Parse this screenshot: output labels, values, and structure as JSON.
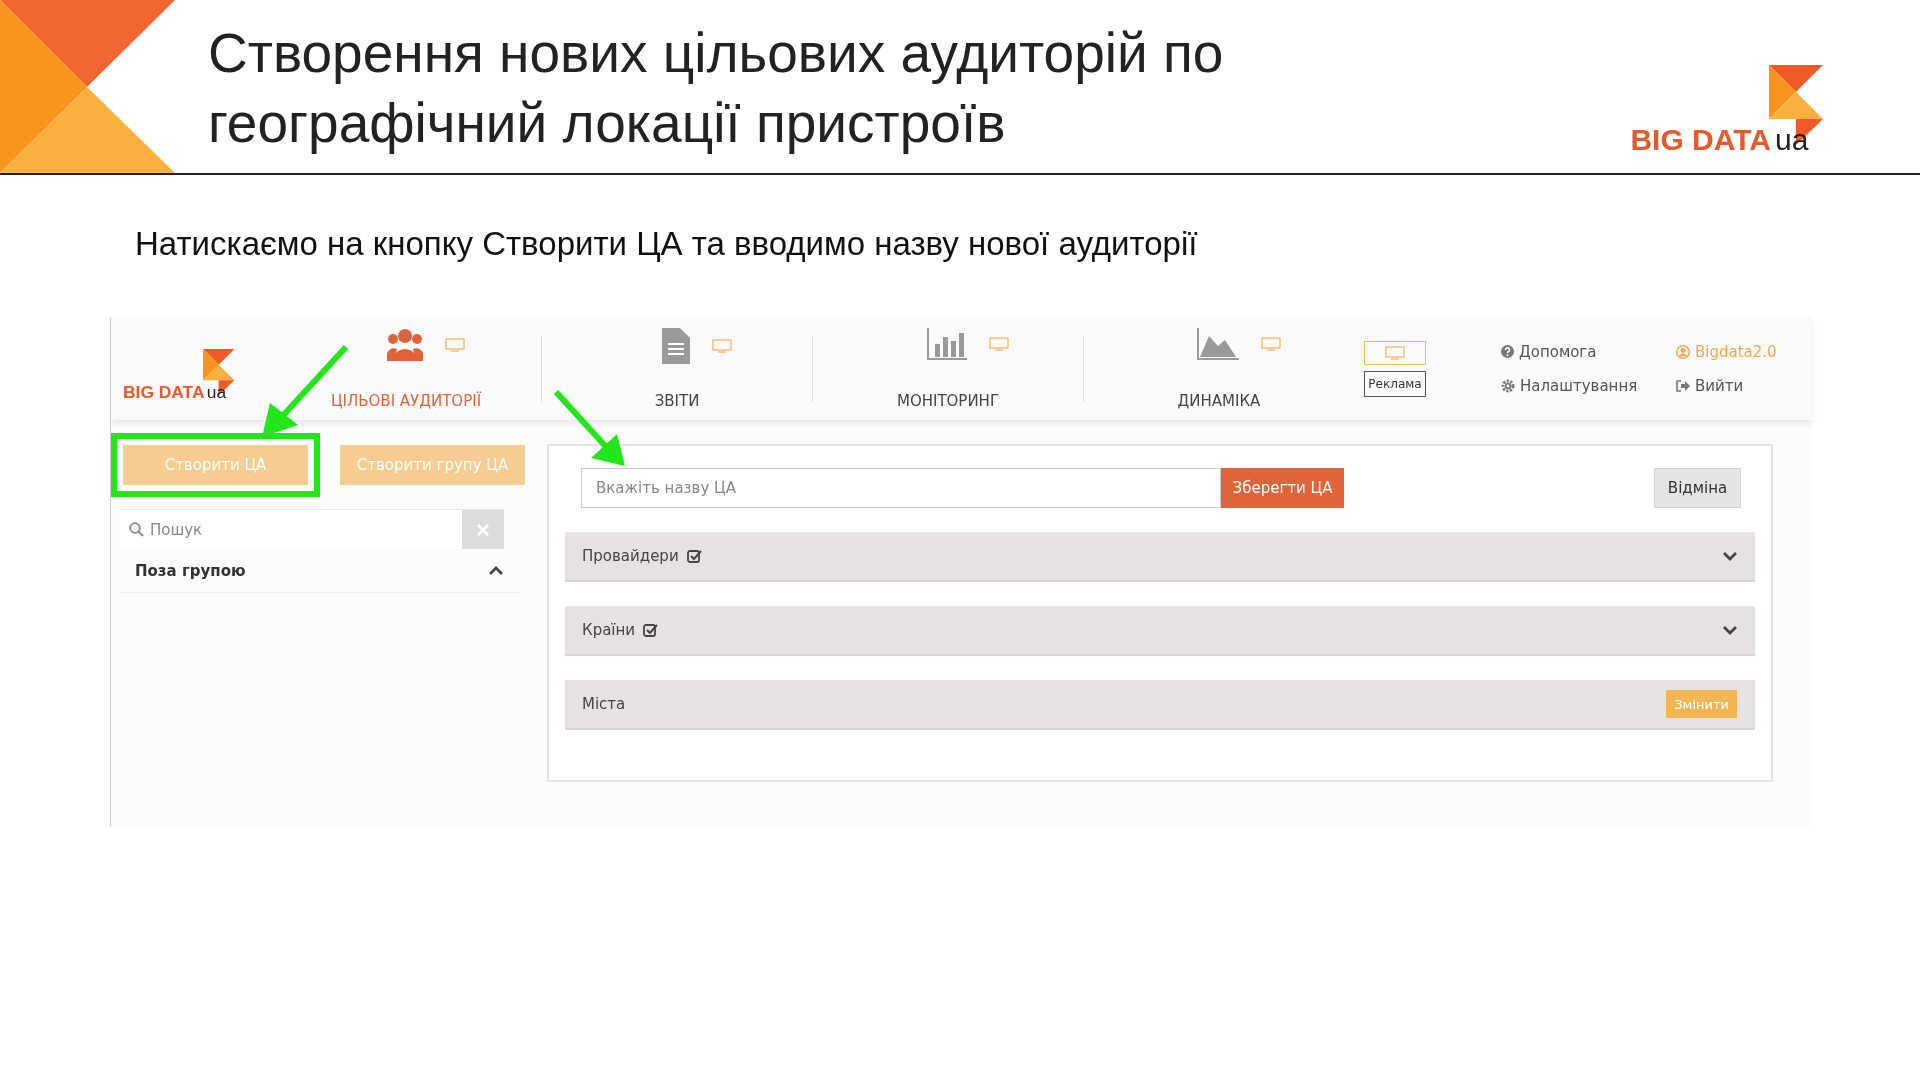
{
  "slide": {
    "title_lines": [
      "Створення нових цільових аудиторій по",
      "географічний локації пристроїв"
    ],
    "logo": {
      "text": "BIG DATA",
      "suffix": "ua"
    },
    "subtitle": "Натискаємо на кнопку Створити ЦА та вводимо назву нової аудиторії"
  },
  "app": {
    "logo": {
      "text": "BIG DATA",
      "suffix": "ua"
    },
    "nav": [
      {
        "kind": "people",
        "label": "ЦІЛЬОВІ АУДИТОРІЇ",
        "selected": true
      },
      {
        "kind": "document",
        "label": "ЗВІТИ",
        "selected": false
      },
      {
        "kind": "bars",
        "label": "МОНІТОРИНГ",
        "selected": false
      },
      {
        "kind": "area",
        "label": "ДИНАМІКА",
        "selected": false
      }
    ],
    "ad_label": "Реклама",
    "links": [
      {
        "kind": "help",
        "label": "Допомога"
      },
      {
        "kind": "user",
        "label": "Bigdata2.0"
      },
      {
        "kind": "settings",
        "label": "Налаштування"
      },
      {
        "kind": "logout",
        "label": "Вийти"
      }
    ],
    "sidebar": {
      "buttons": [
        {
          "label": "Створити ЦА",
          "highlighted": true
        },
        {
          "label": "Створити групу ЦА"
        }
      ],
      "search": {
        "placeholder": "Пошук"
      },
      "groups": [
        {
          "label": "Поза групою",
          "expanded": true
        }
      ]
    },
    "form": {
      "name_placeholder": "Вкажіть назву ЦА",
      "save": "Зберегти ЦА",
      "cancel": "Відміна",
      "sections": [
        {
          "kind": "dropdown",
          "label": "Провайдери",
          "checked": true
        },
        {
          "kind": "dropdown",
          "label": "Країни",
          "checked": true
        },
        {
          "kind": "action",
          "label": "Міста",
          "action": "Змінити"
        }
      ]
    }
  }
}
